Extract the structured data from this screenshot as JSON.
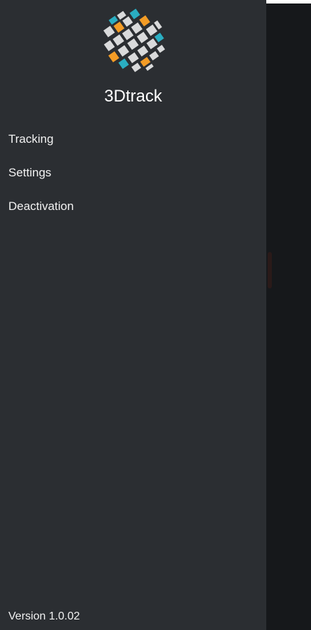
{
  "app": {
    "title": "3Dtrack",
    "logo_icon": "3dtrack-globe-logo-icon",
    "colors": {
      "drawer_background": "#2b2e32",
      "scrim_background": "#16181b",
      "logo_orange": "#f39c26",
      "logo_teal": "#2aaec2",
      "logo_white": "#d9dadb"
    }
  },
  "menu": {
    "items": [
      {
        "label": "Tracking"
      },
      {
        "label": "Settings"
      },
      {
        "label": "Deactivation"
      }
    ]
  },
  "footer": {
    "version": "Version 1.0.02"
  }
}
